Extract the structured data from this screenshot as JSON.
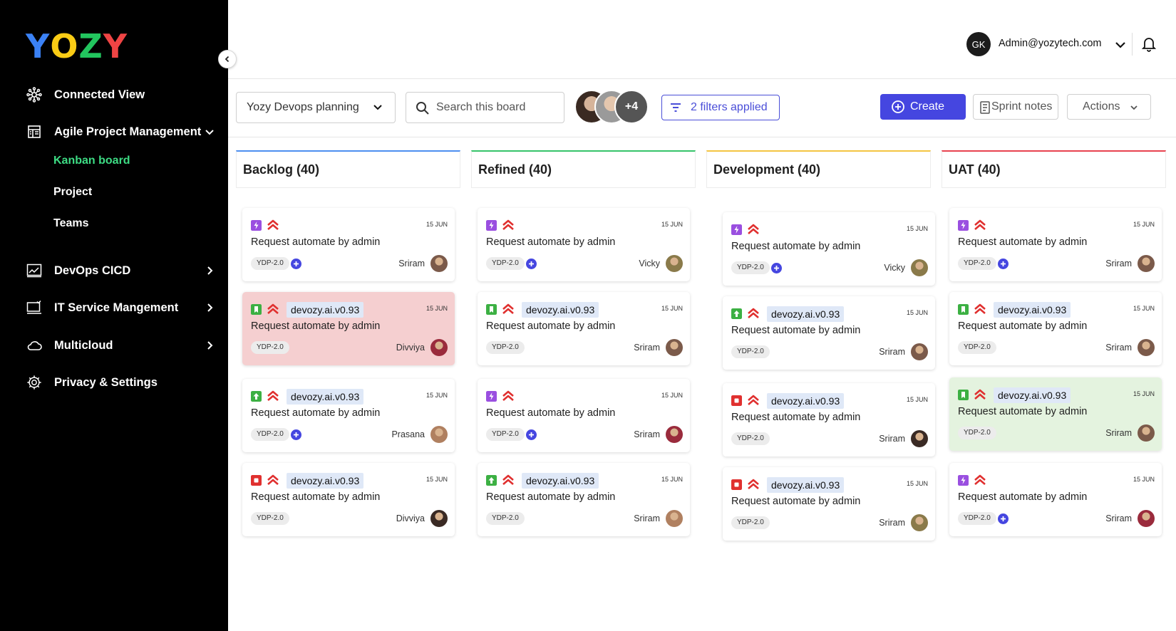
{
  "sidebar": {
    "logo": {
      "letters": [
        "Y",
        "O",
        "Z",
        "Y"
      ],
      "colors": [
        "#3b82f6",
        "#facc15",
        "#22c55e",
        "#ef4444"
      ]
    },
    "items": [
      {
        "label": "Connected View",
        "icon": "network-icon"
      },
      {
        "label": "Agile Project Management",
        "icon": "board-icon",
        "expanded": true
      },
      {
        "label": "DevOps CICD",
        "icon": "chart-icon"
      },
      {
        "label": "IT Service Mangement",
        "icon": "monitor-icon"
      },
      {
        "label": "Multicloud",
        "icon": "cloud-icon"
      },
      {
        "label": "Privacy & Settings",
        "icon": "gear-icon"
      }
    ],
    "subitems": [
      {
        "label": "Kanban board",
        "active": true
      },
      {
        "label": "Project",
        "active": false
      },
      {
        "label": "Teams",
        "active": false
      }
    ]
  },
  "header": {
    "user_initials": "GK",
    "user_email": "Admin@yozytech.com"
  },
  "toolbar": {
    "board_name": "Yozy Devops planning",
    "search_placeholder": "Search this board",
    "members_more": "+4",
    "filters_label": "2 filters applied",
    "create_label": "Create",
    "sprint_notes_label": "Sprint notes",
    "actions_label": "Actions"
  },
  "colors": {
    "accent": "#4546e0",
    "priority": "#e0302f",
    "type_story": "#9a4fe0",
    "type_bookmark": "#3cb043",
    "type_bug": "#e0302f"
  },
  "columns": [
    {
      "title": "Backlog (40)",
      "color": "#4d8ff0",
      "cards": [
        {
          "type": "story",
          "tag": "",
          "date": "15 JUN",
          "title": "Request automate by admin",
          "pill": "YDP-2.0",
          "plus": true,
          "assignee": "Sriram",
          "bg": "white",
          "avatar": "#7b5a4a"
        },
        {
          "type": "bookmark",
          "tag": "devozy.ai.v0.93",
          "date": "15 JUN",
          "title": "Request automate by admin",
          "pill": "YDP-2.0",
          "plus": false,
          "assignee": "Divviya",
          "bg": "pink",
          "avatar": "#9a2b3c"
        },
        {
          "type": "up",
          "tag": "devozy.ai.v0.93",
          "date": "15 JUN",
          "title": "Request automate by admin",
          "pill": "YDP-2.0",
          "plus": true,
          "assignee": "Prasana",
          "bg": "white",
          "avatar": "#b08060"
        },
        {
          "type": "bug",
          "tag": "devozy.ai.v0.93",
          "date": "15 JUN",
          "title": "Request automate by admin",
          "pill": "YDP-2.0",
          "plus": false,
          "assignee": "Divviya",
          "bg": "white",
          "avatar": "#3a2a24"
        }
      ]
    },
    {
      "title": "Refined (40)",
      "color": "#36c46a",
      "cards": [
        {
          "type": "story",
          "tag": "",
          "date": "15 JUN",
          "title": "Request automate by admin",
          "pill": "YDP-2.0",
          "plus": true,
          "assignee": "Vicky",
          "bg": "white",
          "avatar": "#8a7a4a"
        },
        {
          "type": "bookmark",
          "tag": "devozy.ai.v0.93",
          "date": "15 JUN",
          "title": "Request automate by admin",
          "pill": "YDP-2.0",
          "plus": false,
          "assignee": "Sriram",
          "bg": "white",
          "avatar": "#7b5a4a"
        },
        {
          "type": "story",
          "tag": "",
          "date": "15 JUN",
          "title": "Request automate by admin",
          "pill": "YDP-2.0",
          "plus": true,
          "assignee": "Sriram",
          "bg": "white",
          "avatar": "#9a2b3c"
        },
        {
          "type": "up",
          "tag": "devozy.ai.v0.93",
          "date": "15 JUN",
          "title": "Request automate by admin",
          "pill": "YDP-2.0",
          "plus": false,
          "assignee": "Sriram",
          "bg": "white",
          "avatar": "#b08060"
        }
      ]
    },
    {
      "title": "Development (40)",
      "color": "#f4c542",
      "cards": [
        {
          "type": "story",
          "tag": "",
          "date": "15 JUN",
          "title": "Request automate by admin",
          "pill": "YDP-2.0",
          "plus": true,
          "assignee": "Vicky",
          "bg": "white",
          "avatar": "#8a7a4a"
        },
        {
          "type": "up",
          "tag": "devozy.ai.v0.93",
          "date": "15 JUN",
          "title": "Request automate by admin",
          "pill": "YDP-2.0",
          "plus": false,
          "assignee": "Sriram",
          "bg": "white",
          "avatar": "#7b5a4a"
        },
        {
          "type": "bug",
          "tag": "devozy.ai.v0.93",
          "date": "15 JUN",
          "title": "Request automate by admin",
          "pill": "YDP-2.0",
          "plus": false,
          "assignee": "Sriram",
          "bg": "white",
          "avatar": "#3a2a24"
        },
        {
          "type": "bug",
          "tag": "devozy.ai.v0.93",
          "date": "15 JUN",
          "title": "Request automate by admin",
          "pill": "YDP-2.0",
          "plus": false,
          "assignee": "Sriram",
          "bg": "white",
          "avatar": "#8a7a4a"
        }
      ]
    },
    {
      "title": "UAT (40)",
      "color": "#e8434f",
      "cards": [
        {
          "type": "story",
          "tag": "",
          "date": "15 JUN",
          "title": "Request automate by admin",
          "pill": "YDP-2.0",
          "plus": true,
          "assignee": "Sriram",
          "bg": "white",
          "avatar": "#7b5a4a"
        },
        {
          "type": "bookmark",
          "tag": "devozy.ai.v0.93",
          "date": "15 JUN",
          "title": "Request automate by admin",
          "pill": "YDP-2.0",
          "plus": false,
          "assignee": "Sriram",
          "bg": "white",
          "avatar": "#7b5a4a"
        },
        {
          "type": "bookmark",
          "tag": "devozy.ai.v0.93",
          "date": "15 JUN",
          "title": "Request automate by admin",
          "pill": "YDP-2.0",
          "plus": false,
          "assignee": "Sriram",
          "bg": "green",
          "avatar": "#7b5a4a"
        },
        {
          "type": "story",
          "tag": "",
          "date": "15 JUN",
          "title": "Request automate by admin",
          "pill": "YDP-2.0",
          "plus": true,
          "assignee": "Sriram",
          "bg": "white",
          "avatar": "#9a2b3c"
        }
      ]
    }
  ]
}
